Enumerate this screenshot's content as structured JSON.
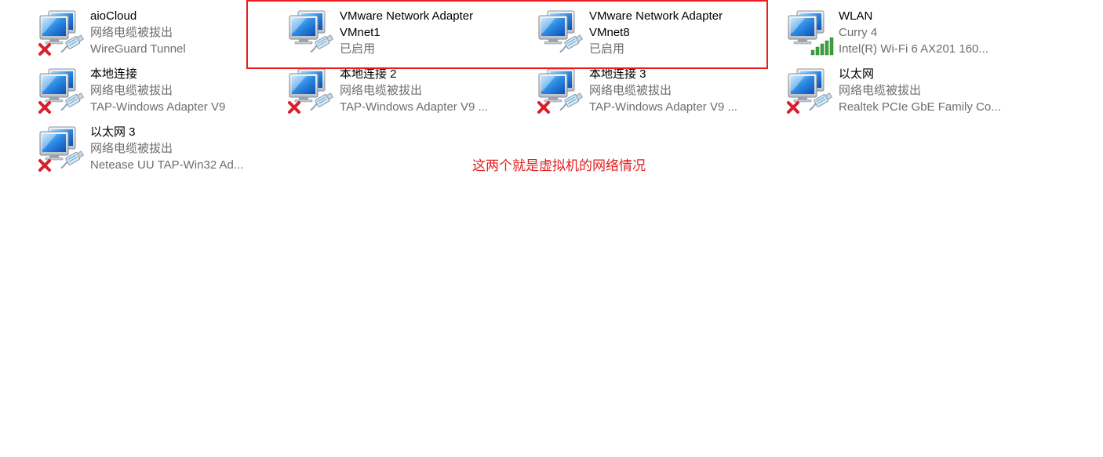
{
  "adapters": [
    {
      "name": "aioCloud",
      "status": "网络电缆被拔出",
      "device": "WireGuard Tunnel",
      "icon": "wired-disconnected"
    },
    {
      "name": "VMware Network Adapter VMnet1",
      "name_line1": "VMware Network Adapter",
      "name_line2": "VMnet1",
      "status": "已启用",
      "icon": "wired-enabled"
    },
    {
      "name": "VMware Network Adapter VMnet8",
      "name_line1": "VMware Network Adapter",
      "name_line2": "VMnet8",
      "status": "已启用",
      "icon": "wired-enabled"
    },
    {
      "name": "WLAN",
      "status": "Curry 4",
      "device": "Intel(R) Wi-Fi 6 AX201 160...",
      "icon": "wifi-connected"
    },
    {
      "name": "本地连接",
      "status": "网络电缆被拔出",
      "device": "TAP-Windows Adapter V9",
      "icon": "wired-disconnected"
    },
    {
      "name": "本地连接 2",
      "status": "网络电缆被拔出",
      "device": "TAP-Windows Adapter V9 ...",
      "icon": "wired-disconnected"
    },
    {
      "name": "本地连接 3",
      "status": "网络电缆被拔出",
      "device": "TAP-Windows Adapter V9 ...",
      "icon": "wired-disconnected"
    },
    {
      "name": "以太网",
      "status": "网络电缆被拔出",
      "device": "Realtek PCIe GbE Family Co...",
      "icon": "wired-disconnected"
    },
    {
      "name": "以太网 3",
      "status": "网络电缆被拔出",
      "device": "Netease UU TAP-Win32 Ad...",
      "icon": "wired-disconnected"
    }
  ],
  "annotation": {
    "text": "这两个就是虚拟机的网络情况",
    "color": "#e41e1e"
  },
  "colors": {
    "highlight_border": "#ee1c1c",
    "disconnected_x": "#d7202b",
    "wifi_bars": "#3ca03c",
    "secondary_text": "#6d6d6d"
  }
}
